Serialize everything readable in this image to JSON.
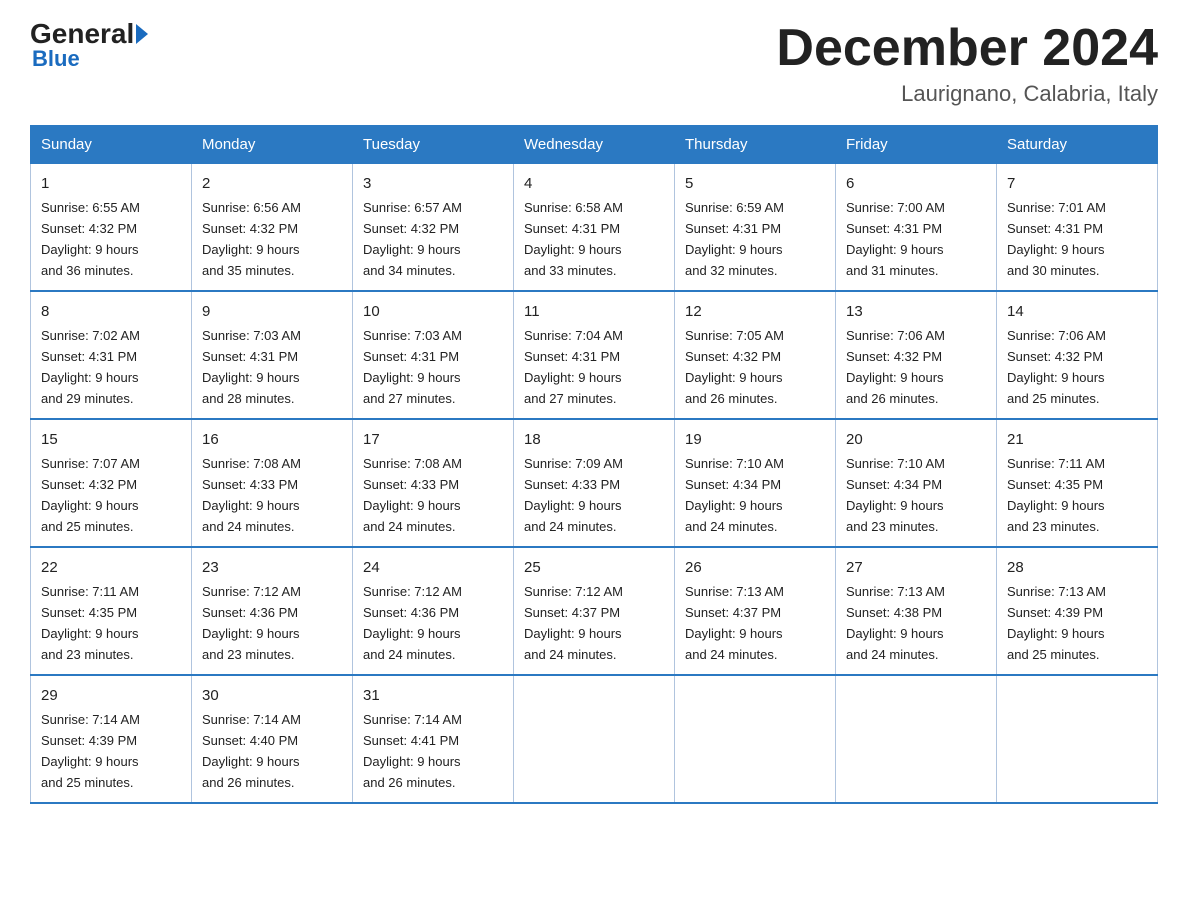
{
  "header": {
    "logo_general": "General",
    "logo_blue": "Blue",
    "month_title": "December 2024",
    "location": "Laurignano, Calabria, Italy"
  },
  "days_of_week": [
    "Sunday",
    "Monday",
    "Tuesday",
    "Wednesday",
    "Thursday",
    "Friday",
    "Saturday"
  ],
  "weeks": [
    [
      {
        "day": "1",
        "sunrise": "6:55 AM",
        "sunset": "4:32 PM",
        "daylight": "9 hours and 36 minutes."
      },
      {
        "day": "2",
        "sunrise": "6:56 AM",
        "sunset": "4:32 PM",
        "daylight": "9 hours and 35 minutes."
      },
      {
        "day": "3",
        "sunrise": "6:57 AM",
        "sunset": "4:32 PM",
        "daylight": "9 hours and 34 minutes."
      },
      {
        "day": "4",
        "sunrise": "6:58 AM",
        "sunset": "4:31 PM",
        "daylight": "9 hours and 33 minutes."
      },
      {
        "day": "5",
        "sunrise": "6:59 AM",
        "sunset": "4:31 PM",
        "daylight": "9 hours and 32 minutes."
      },
      {
        "day": "6",
        "sunrise": "7:00 AM",
        "sunset": "4:31 PM",
        "daylight": "9 hours and 31 minutes."
      },
      {
        "day": "7",
        "sunrise": "7:01 AM",
        "sunset": "4:31 PM",
        "daylight": "9 hours and 30 minutes."
      }
    ],
    [
      {
        "day": "8",
        "sunrise": "7:02 AM",
        "sunset": "4:31 PM",
        "daylight": "9 hours and 29 minutes."
      },
      {
        "day": "9",
        "sunrise": "7:03 AM",
        "sunset": "4:31 PM",
        "daylight": "9 hours and 28 minutes."
      },
      {
        "day": "10",
        "sunrise": "7:03 AM",
        "sunset": "4:31 PM",
        "daylight": "9 hours and 27 minutes."
      },
      {
        "day": "11",
        "sunrise": "7:04 AM",
        "sunset": "4:31 PM",
        "daylight": "9 hours and 27 minutes."
      },
      {
        "day": "12",
        "sunrise": "7:05 AM",
        "sunset": "4:32 PM",
        "daylight": "9 hours and 26 minutes."
      },
      {
        "day": "13",
        "sunrise": "7:06 AM",
        "sunset": "4:32 PM",
        "daylight": "9 hours and 26 minutes."
      },
      {
        "day": "14",
        "sunrise": "7:06 AM",
        "sunset": "4:32 PM",
        "daylight": "9 hours and 25 minutes."
      }
    ],
    [
      {
        "day": "15",
        "sunrise": "7:07 AM",
        "sunset": "4:32 PM",
        "daylight": "9 hours and 25 minutes."
      },
      {
        "day": "16",
        "sunrise": "7:08 AM",
        "sunset": "4:33 PM",
        "daylight": "9 hours and 24 minutes."
      },
      {
        "day": "17",
        "sunrise": "7:08 AM",
        "sunset": "4:33 PM",
        "daylight": "9 hours and 24 minutes."
      },
      {
        "day": "18",
        "sunrise": "7:09 AM",
        "sunset": "4:33 PM",
        "daylight": "9 hours and 24 minutes."
      },
      {
        "day": "19",
        "sunrise": "7:10 AM",
        "sunset": "4:34 PM",
        "daylight": "9 hours and 24 minutes."
      },
      {
        "day": "20",
        "sunrise": "7:10 AM",
        "sunset": "4:34 PM",
        "daylight": "9 hours and 23 minutes."
      },
      {
        "day": "21",
        "sunrise": "7:11 AM",
        "sunset": "4:35 PM",
        "daylight": "9 hours and 23 minutes."
      }
    ],
    [
      {
        "day": "22",
        "sunrise": "7:11 AM",
        "sunset": "4:35 PM",
        "daylight": "9 hours and 23 minutes."
      },
      {
        "day": "23",
        "sunrise": "7:12 AM",
        "sunset": "4:36 PM",
        "daylight": "9 hours and 23 minutes."
      },
      {
        "day": "24",
        "sunrise": "7:12 AM",
        "sunset": "4:36 PM",
        "daylight": "9 hours and 24 minutes."
      },
      {
        "day": "25",
        "sunrise": "7:12 AM",
        "sunset": "4:37 PM",
        "daylight": "9 hours and 24 minutes."
      },
      {
        "day": "26",
        "sunrise": "7:13 AM",
        "sunset": "4:37 PM",
        "daylight": "9 hours and 24 minutes."
      },
      {
        "day": "27",
        "sunrise": "7:13 AM",
        "sunset": "4:38 PM",
        "daylight": "9 hours and 24 minutes."
      },
      {
        "day": "28",
        "sunrise": "7:13 AM",
        "sunset": "4:39 PM",
        "daylight": "9 hours and 25 minutes."
      }
    ],
    [
      {
        "day": "29",
        "sunrise": "7:14 AM",
        "sunset": "4:39 PM",
        "daylight": "9 hours and 25 minutes."
      },
      {
        "day": "30",
        "sunrise": "7:14 AM",
        "sunset": "4:40 PM",
        "daylight": "9 hours and 26 minutes."
      },
      {
        "day": "31",
        "sunrise": "7:14 AM",
        "sunset": "4:41 PM",
        "daylight": "9 hours and 26 minutes."
      },
      null,
      null,
      null,
      null
    ]
  ],
  "labels": {
    "sunrise": "Sunrise:",
    "sunset": "Sunset:",
    "daylight": "Daylight:"
  }
}
